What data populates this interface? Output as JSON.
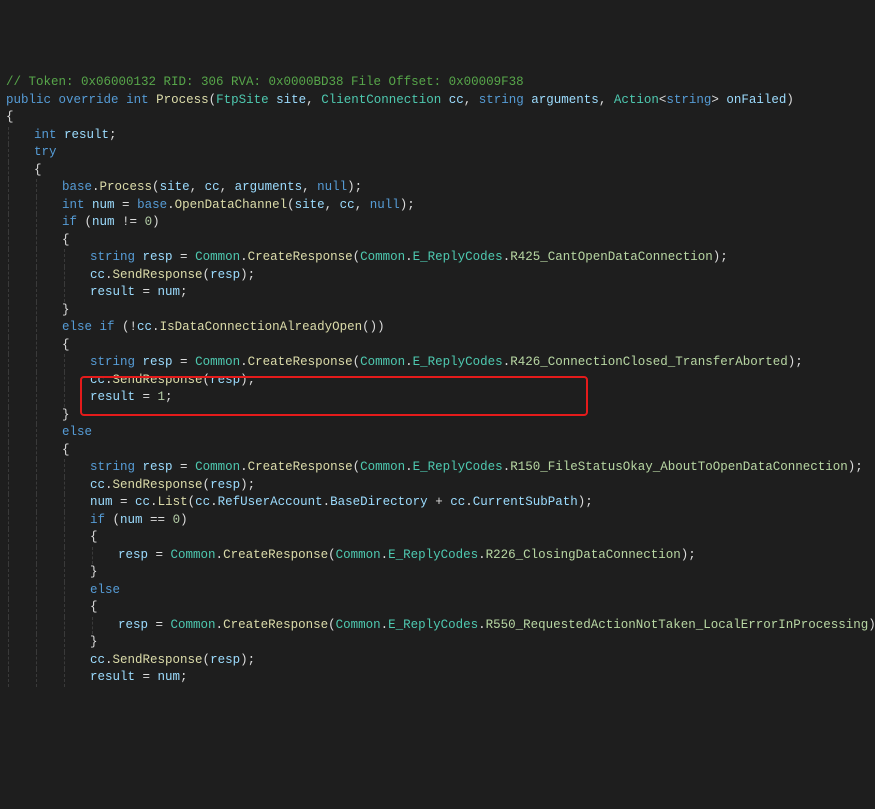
{
  "comment_header": "// Token: 0x06000132 RID: 306 RVA: 0x0000BD38 File Offset: 0x00009F38",
  "sig": {
    "public": "public",
    "override": "override",
    "int": "int",
    "Process": "Process",
    "FtpSite": "FtpSite",
    "site": "site",
    "ClientConnection": "ClientConnection",
    "cc": "cc",
    "string": "string",
    "arguments": "arguments",
    "Action": "Action",
    "onFailed": "onFailed"
  },
  "kw": {
    "int": "int",
    "try": "try",
    "base": "base",
    "null": "null",
    "if": "if",
    "else": "else",
    "else_if": "else if",
    "string": "string"
  },
  "ids": {
    "result": "result",
    "num": "num",
    "resp": "resp",
    "site": "site",
    "cc": "cc",
    "arguments": "arguments"
  },
  "methods": {
    "Process": "Process",
    "OpenDataChannel": "OpenDataChannel",
    "CreateResponse": "CreateResponse",
    "SendResponse": "SendResponse",
    "IsDataConnectionAlreadyOpen": "IsDataConnectionAlreadyOpen",
    "List": "List"
  },
  "classes": {
    "Common": "Common",
    "E_ReplyCodes": "E_ReplyCodes"
  },
  "enums": {
    "R425": "R425_CantOpenDataConnection",
    "R426": "R426_ConnectionClosed_TransferAborted",
    "R150": "R150_FileStatusOkay_AboutToOpenDataConnection",
    "R226": "R226_ClosingDataConnection",
    "R550": "R550_RequestedActionNotTaken_LocalErrorInProcessing"
  },
  "props": {
    "RefUserAccount": "RefUserAccount",
    "BaseDirectory": "BaseDirectory",
    "CurrentSubPath": "CurrentSubPath"
  },
  "nums": {
    "zero": "0",
    "one": "1"
  },
  "ops": {
    "neq_zero": "(num != 0)",
    "eq_zero": "(num == 0)",
    "not_open": "(!cc.",
    "close_callparen": "())"
  }
}
